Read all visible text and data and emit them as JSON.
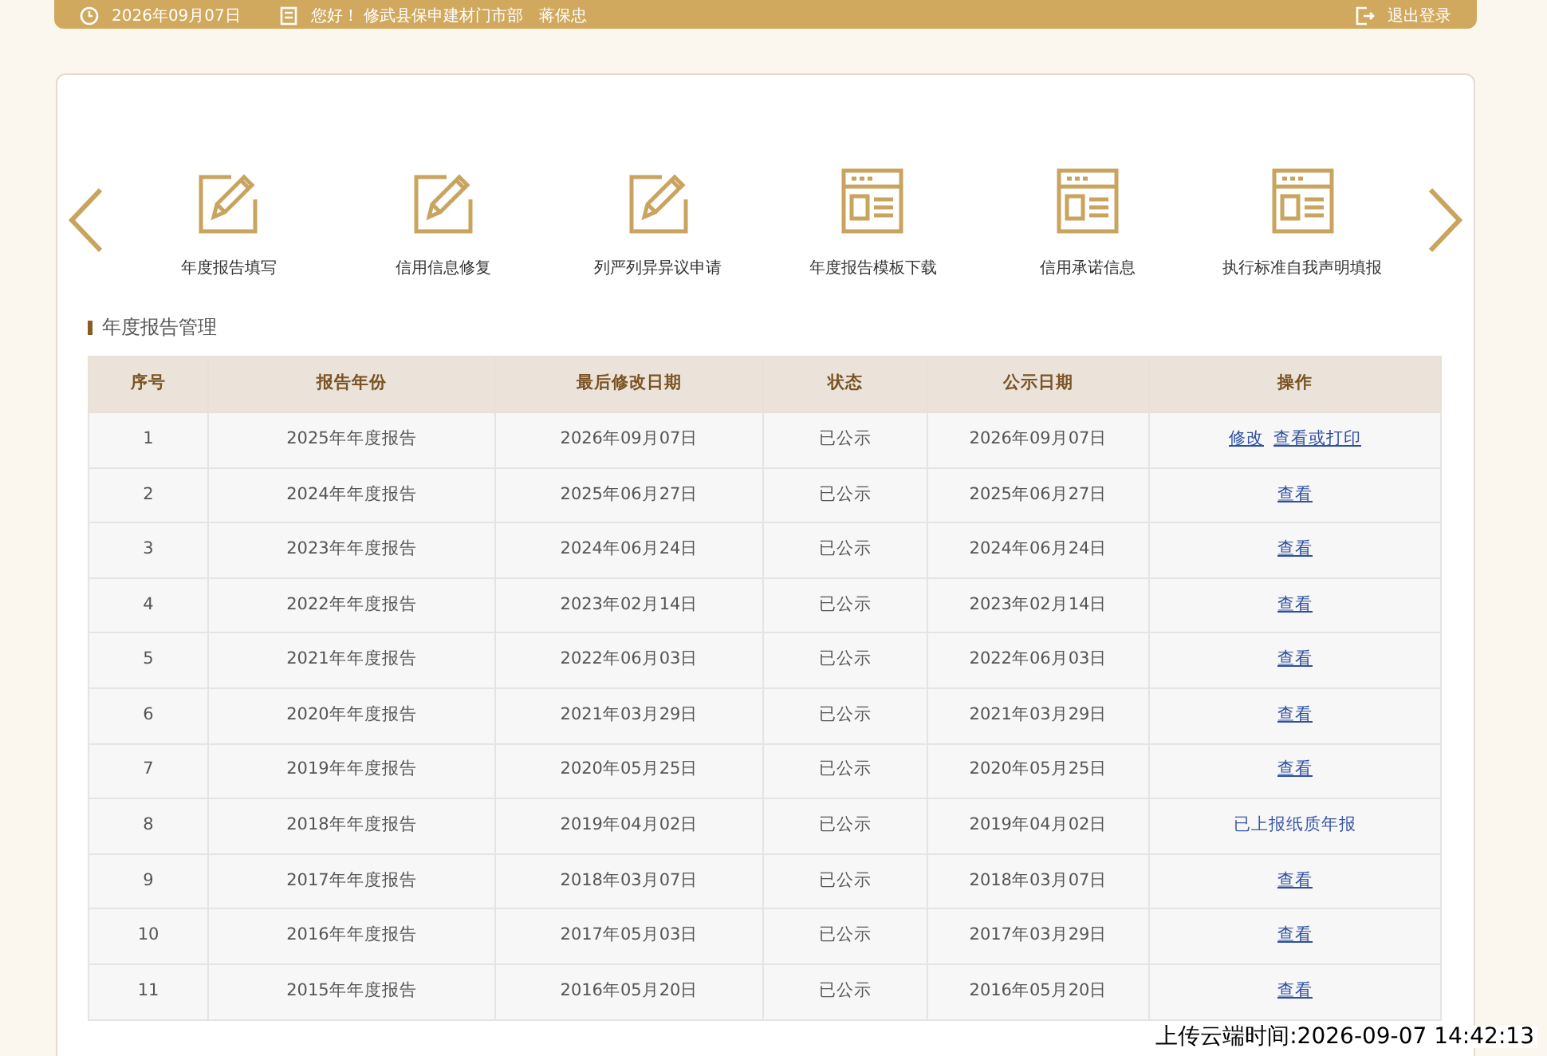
{
  "top_bar": {
    "date": "2026年09月07日",
    "greeting": "您好！ 修武县保申建材门市部　蒋保忠",
    "logout": "退出登录"
  },
  "shortcuts": [
    {
      "label": "年度报告填写",
      "kind": "edit"
    },
    {
      "label": "信用信息修复",
      "kind": "edit"
    },
    {
      "label": "列严列异异议申请",
      "kind": "edit"
    },
    {
      "label": "年度报告模板下载",
      "kind": "page"
    },
    {
      "label": "信用承诺信息",
      "kind": "page"
    },
    {
      "label": "执行标准自我声明填报",
      "kind": "page"
    }
  ],
  "section_title": "年度报告管理",
  "table": {
    "columns": [
      "序号",
      "报告年份",
      "最后修改日期",
      "状态",
      "公示日期",
      "操作"
    ],
    "rows": [
      {
        "cells": [
          "1",
          "2025年年度报告",
          "2026年09月07日",
          "已公示",
          "2026年09月07日"
        ],
        "actions": [
          {
            "text": "修改",
            "kind": "link"
          },
          {
            "text": "查看或打印",
            "kind": "link"
          }
        ]
      },
      {
        "cells": [
          "2",
          "2024年年度报告",
          "2025年06月27日",
          "已公示",
          "2025年06月27日"
        ],
        "actions": [
          {
            "text": "查看",
            "kind": "link"
          }
        ]
      },
      {
        "cells": [
          "3",
          "2023年年度报告",
          "2024年06月24日",
          "已公示",
          "2024年06月24日"
        ],
        "actions": [
          {
            "text": "查看",
            "kind": "link"
          }
        ]
      },
      {
        "cells": [
          "4",
          "2022年年度报告",
          "2023年02月14日",
          "已公示",
          "2023年02月14日"
        ],
        "actions": [
          {
            "text": "查看",
            "kind": "link"
          }
        ]
      },
      {
        "cells": [
          "5",
          "2021年年度报告",
          "2022年06月03日",
          "已公示",
          "2022年06月03日"
        ],
        "actions": [
          {
            "text": "查看",
            "kind": "link"
          }
        ]
      },
      {
        "cells": [
          "6",
          "2020年年度报告",
          "2021年03月29日",
          "已公示",
          "2021年03月29日"
        ],
        "actions": [
          {
            "text": "查看",
            "kind": "link"
          }
        ]
      },
      {
        "cells": [
          "7",
          "2019年年度报告",
          "2020年05月25日",
          "已公示",
          "2020年05月25日"
        ],
        "actions": [
          {
            "text": "查看",
            "kind": "link"
          }
        ]
      },
      {
        "cells": [
          "8",
          "2018年年度报告",
          "2019年04月02日",
          "已公示",
          "2019年04月02日"
        ],
        "actions": [
          {
            "text": "已上报纸质年报",
            "kind": "text"
          }
        ]
      },
      {
        "cells": [
          "9",
          "2017年年度报告",
          "2018年03月07日",
          "已公示",
          "2018年03月07日"
        ],
        "actions": [
          {
            "text": "查看",
            "kind": "link"
          }
        ]
      },
      {
        "cells": [
          "10",
          "2016年年度报告",
          "2017年05月03日",
          "已公示",
          "2017年03月29日"
        ],
        "actions": [
          {
            "text": "查看",
            "kind": "link"
          }
        ]
      },
      {
        "cells": [
          "11",
          "2015年年度报告",
          "2016年05月20日",
          "已公示",
          "2016年05月20日"
        ],
        "actions": [
          {
            "text": "查看",
            "kind": "link"
          }
        ]
      }
    ]
  },
  "upload_time": "上传云端时间:2026-09-07 14:42:13"
}
